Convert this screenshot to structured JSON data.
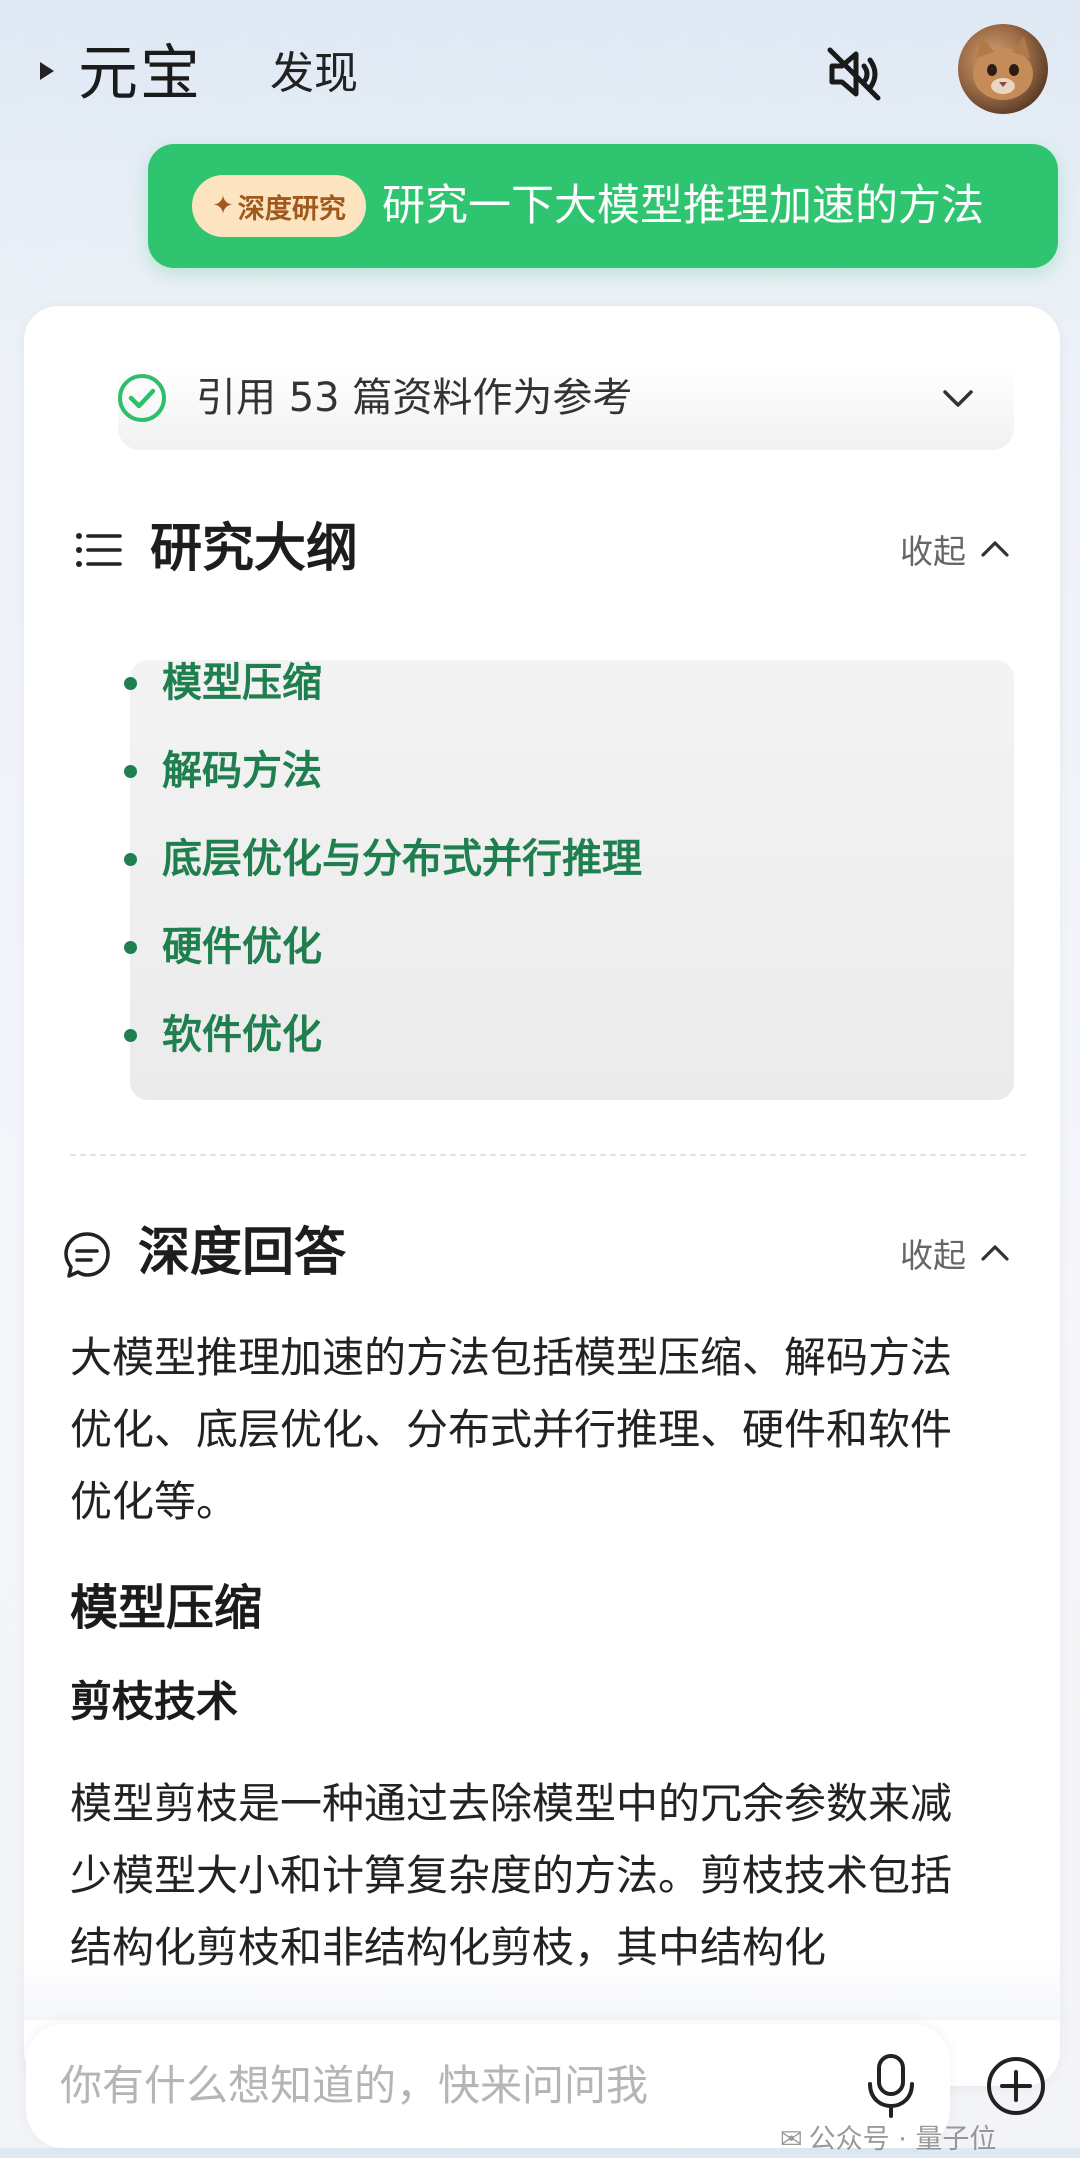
{
  "header": {
    "app_title": "元宝",
    "discover_tab": "发现",
    "icons": {
      "expand": "expand-triangle-icon",
      "mute": "speaker-mute-icon",
      "avatar": "user-avatar"
    }
  },
  "prompt": {
    "badge_label": "深度研究",
    "text": "研究一下大模型推理加速的方法",
    "bubble_color": "#2fc46f"
  },
  "references": {
    "text": "引用 53 篇资料作为参考",
    "icon": "check-circle-icon"
  },
  "outline": {
    "title": "研究大纲",
    "collapse_label": "收起",
    "items": [
      "模型压缩",
      "解码方法",
      "底层优化与分布式并行推理",
      "硬件优化",
      "软件优化"
    ],
    "item_color": "#1f7f4e"
  },
  "answer": {
    "title": "深度回答",
    "collapse_label": "收起",
    "intro": "大模型推理加速的方法包括模型压缩、解码方法优化、底层优化、分布式并行推理、硬件和软件优化等。",
    "section_title": "模型压缩",
    "subsection_title": "剪枝技术",
    "paragraph": "模型剪枝是一种通过去除模型中的冗余参数来减少模型大小和计算复杂度的方法。剪枝技术包括结构化剪枝和非结构化剪枝，其中结构化"
  },
  "input": {
    "placeholder": "你有什么想知道的，快来问问我"
  },
  "watermark": {
    "text": "公众号 · 量子位"
  }
}
